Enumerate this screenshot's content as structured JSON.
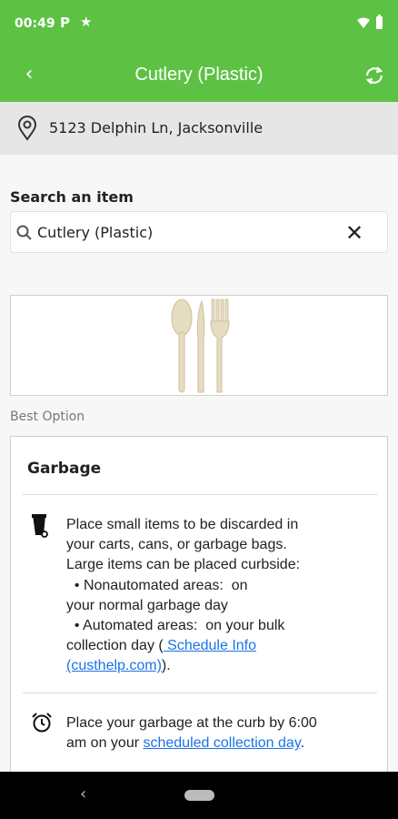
{
  "status_bar": {
    "time": "00:49",
    "parking_glyph": "P",
    "icons": [
      "parking-icon",
      "star-icon",
      "wifi-icon",
      "battery-icon"
    ]
  },
  "app_bar": {
    "title": "Cutlery (Plastic)",
    "back_glyph": "‹",
    "color": "#5dc244"
  },
  "location": {
    "address": "5123 Delphin Ln, Jacksonville"
  },
  "search": {
    "label": "Search an item",
    "value": "Cutlery (Plastic)",
    "clear_glyph": "✕"
  },
  "best_option_label": "Best Option",
  "card": {
    "heading": "Garbage",
    "instructions": {
      "lines": [
        "Place small items to be discarded in",
        "your carts, cans, or garbage bags.",
        "Large items can be placed curbside:",
        "  • Nonautomated areas:  on",
        "your normal garbage day",
        "  • Automated areas:  on your bulk"
      ],
      "last_prefix": "collection day (",
      "link_part1": " Schedule Info",
      "link_part2": "(custhelp.com)",
      "suffix": ")."
    },
    "timing": {
      "line1": "Place your garbage at the curb by 6:00",
      "line2_prefix": "am on your ",
      "link": "scheduled collection day",
      "line2_suffix": "."
    }
  },
  "nav_bar": {
    "back_glyph": "‹"
  }
}
